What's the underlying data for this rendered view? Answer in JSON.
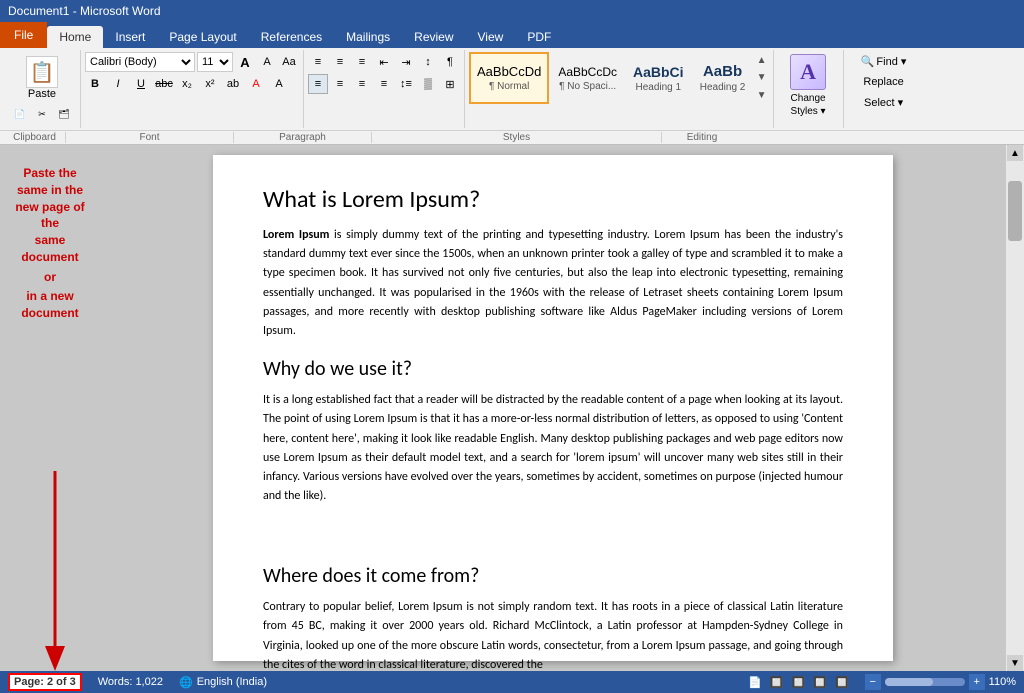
{
  "titleBar": {
    "title": "Document1 - Microsoft Word"
  },
  "tabs": [
    {
      "id": "file",
      "label": "File",
      "active": false
    },
    {
      "id": "home",
      "label": "Home",
      "active": true
    },
    {
      "id": "insert",
      "label": "Insert",
      "active": false
    },
    {
      "id": "page-layout",
      "label": "Page Layout",
      "active": false
    },
    {
      "id": "references",
      "label": "References",
      "active": false
    },
    {
      "id": "mailings",
      "label": "Mailings",
      "active": false
    },
    {
      "id": "review",
      "label": "Review",
      "active": false
    },
    {
      "id": "view",
      "label": "View",
      "active": false
    },
    {
      "id": "pdf",
      "label": "PDF",
      "active": false
    }
  ],
  "clipboard": {
    "label": "Clipboard",
    "paste_label": "Paste"
  },
  "font": {
    "label": "Font",
    "name": "Calibri (Body)",
    "size": "11",
    "grow_label": "A",
    "shrink_label": "A",
    "case_label": "Aa",
    "bold": "B",
    "italic": "I",
    "underline": "U",
    "strikethrough": "abc",
    "subscript": "x₂",
    "superscript": "x²",
    "color_label": "A",
    "highlight_label": "ab"
  },
  "paragraph": {
    "label": "Paragraph",
    "bullets_label": "≡",
    "numbering_label": "≡",
    "multilevel_label": "≡",
    "decrease_indent": "←≡",
    "increase_indent": "→≡",
    "sort_label": "A↓",
    "show_hide_label": "¶",
    "align_left": "≡",
    "align_center": "≡",
    "align_right": "≡",
    "justify": "≡",
    "line_spacing": "≡",
    "shading": "▒",
    "borders": "⊞"
  },
  "styles": {
    "label": "Styles",
    "items": [
      {
        "id": "normal",
        "preview": "AaBbCcDd",
        "label": "¶ Normal",
        "active": true
      },
      {
        "id": "nospace",
        "preview": "AaBbCcDc",
        "label": "¶ No Spaci...",
        "active": false
      },
      {
        "id": "heading1",
        "preview": "AaBbCi",
        "label": "Heading 1",
        "active": false
      },
      {
        "id": "heading2",
        "preview": "AaBb",
        "label": "Heading 2",
        "active": false
      }
    ]
  },
  "changeStyles": {
    "label": "Change\nStyles ▾",
    "icon": "A"
  },
  "editing": {
    "label": "Editing",
    "find_label": "Find ▾",
    "replace_label": "Replace",
    "select_label": "Select ▾"
  },
  "annotation": {
    "line1": "Paste the",
    "line2": "same in the",
    "line3": "new page of the",
    "line4": "same document",
    "or": "or",
    "line5": "in a new",
    "line6": "document"
  },
  "document": {
    "heading1": "What is Lorem Ipsum?",
    "para1_bold": "Lorem Ipsum",
    "para1_rest": " is simply dummy text of the printing and typesetting industry. Lorem Ipsum has been the industry's standard dummy text ever since the 1500s, when an unknown printer took a galley of type and scrambled it to make a type specimen book. It has survived not only five centuries, but also the leap into electronic typesetting, remaining essentially unchanged. It was popularised in the 1960s with the release of Letraset sheets containing Lorem Ipsum passages, and more recently with desktop publishing software like Aldus PageMaker including versions of Lorem Ipsum.",
    "heading2": "Why do we use it?",
    "para2": "It is a long established fact that a reader will be distracted by the readable content of a page when looking at its layout. The point of using Lorem Ipsum is that it has a more-or-less normal distribution of letters, as opposed to using 'Content here, content here', making it look like readable English. Many desktop publishing packages and web page editors now use Lorem Ipsum as their default model text, and a search for 'lorem ipsum' will uncover many web sites still in their infancy. Various versions have evolved over the years, sometimes by accident, sometimes on purpose (injected humour and the like).",
    "heading3": "Where does it come from?",
    "para3": "Contrary to popular belief, Lorem Ipsum is not simply random text. It has roots in a piece of classical Latin literature from 45 BC, making it over 2000 years old. Richard McClintock, a Latin professor at Hampden-Sydney College in Virginia, looked up one of the more obscure Latin words, consectetur, from a Lorem Ipsum passage, and going through the cites of the word in classical literature, discovered the"
  },
  "statusBar": {
    "page_label": "Page:",
    "page_current": "2",
    "page_total": "3",
    "page_display": "Page: 2 of 3",
    "words_label": "Words: 1,022",
    "language": "English (India)",
    "zoom": "110%",
    "zoom_out": "-",
    "zoom_in": "+"
  }
}
